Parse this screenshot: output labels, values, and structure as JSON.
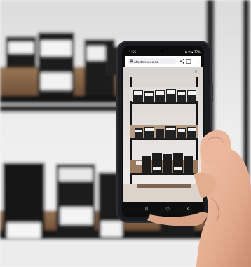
{
  "status_bar": {
    "time": "1:55",
    "indicators": "✱ ✆ ▾ 77%"
  },
  "browser": {
    "url": "afastener.co.nz",
    "close_glyph": "✕",
    "menu_glyph": "⋮"
  },
  "nav_bar": {
    "recents_glyph": "|||",
    "home_glyph": "○",
    "back_glyph": "‹"
  },
  "colors": {
    "shelf_metal": "#141414",
    "shelf_board_wood": "#8a6a4c",
    "bin_black": "#1c1c1c",
    "bin_label_white": "#f2f2f2",
    "phone_case": "#2d2f34",
    "skin": "#e7b49c",
    "wall": "#f0f0f0"
  },
  "icons": [
    "lock-icon",
    "share-icon",
    "more-vert-icon",
    "close-icon",
    "recents-icon",
    "home-icon",
    "back-icon"
  ]
}
